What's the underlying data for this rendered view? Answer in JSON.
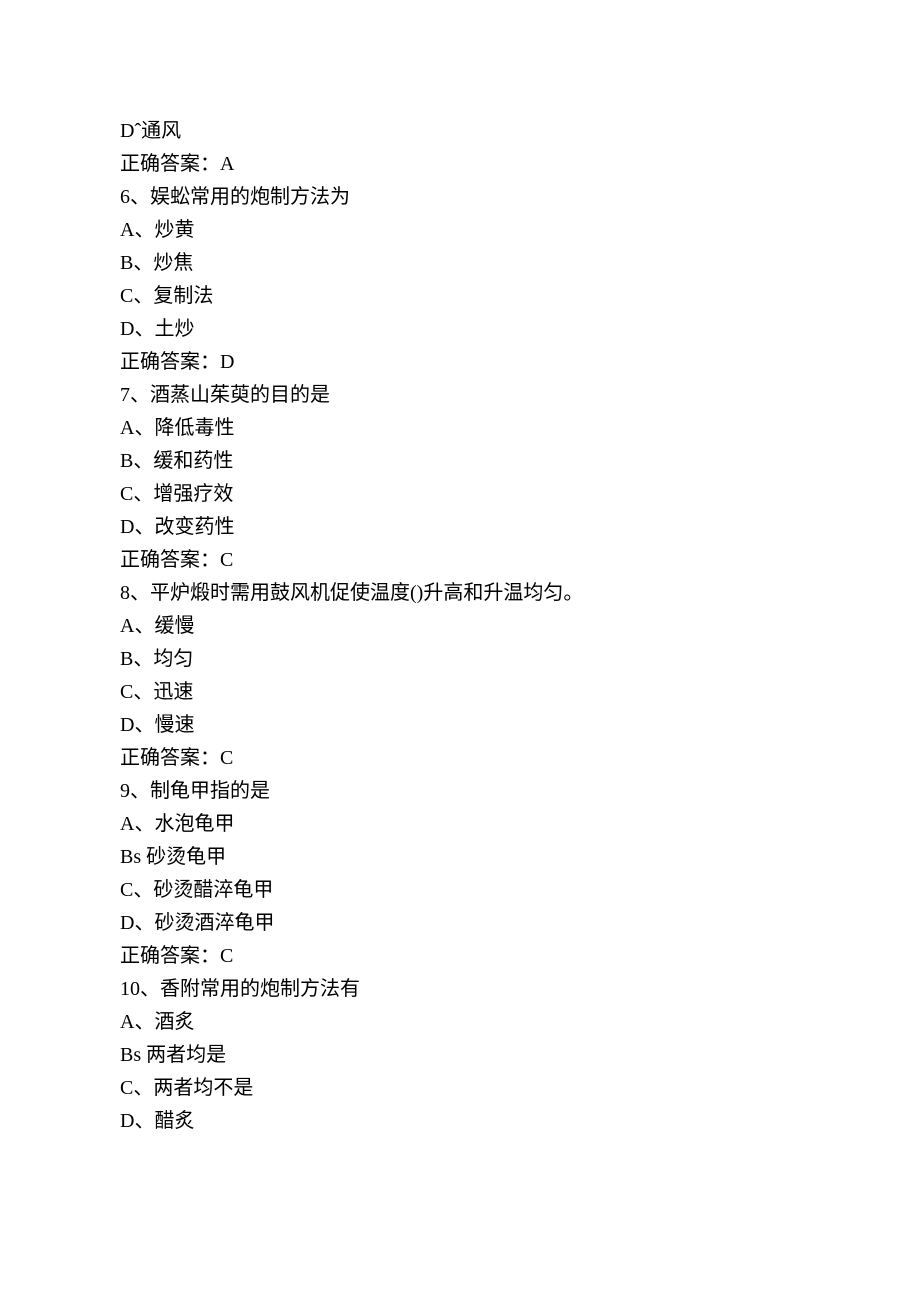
{
  "lines": [
    "Dˆ通风",
    "正确答案：A",
    "6、娱蚣常用的炮制方法为",
    "A、炒黄",
    "B、炒焦",
    "C、复制法",
    "D、土炒",
    "正确答案：D",
    "7、酒蒸山茱萸的目的是",
    "A、降低毒性",
    "B、缓和药性",
    "C、增强疗效",
    "D、改变药性",
    "正确答案：C",
    "8、平炉煅时需用鼓风机促使温度()升高和升温均匀。",
    "A、缓慢",
    "B、均匀",
    "C、迅速",
    "D、慢速",
    "正确答案：C",
    "9、制龟甲指的是",
    "A、水泡龟甲",
    "Bs 砂烫龟甲",
    "C、砂烫醋淬龟甲",
    "D、砂烫酒淬龟甲",
    "正确答案：C",
    "10、香附常用的炮制方法有",
    "A、酒炙",
    "Bs 两者均是",
    "C、两者均不是",
    "D、醋炙"
  ]
}
